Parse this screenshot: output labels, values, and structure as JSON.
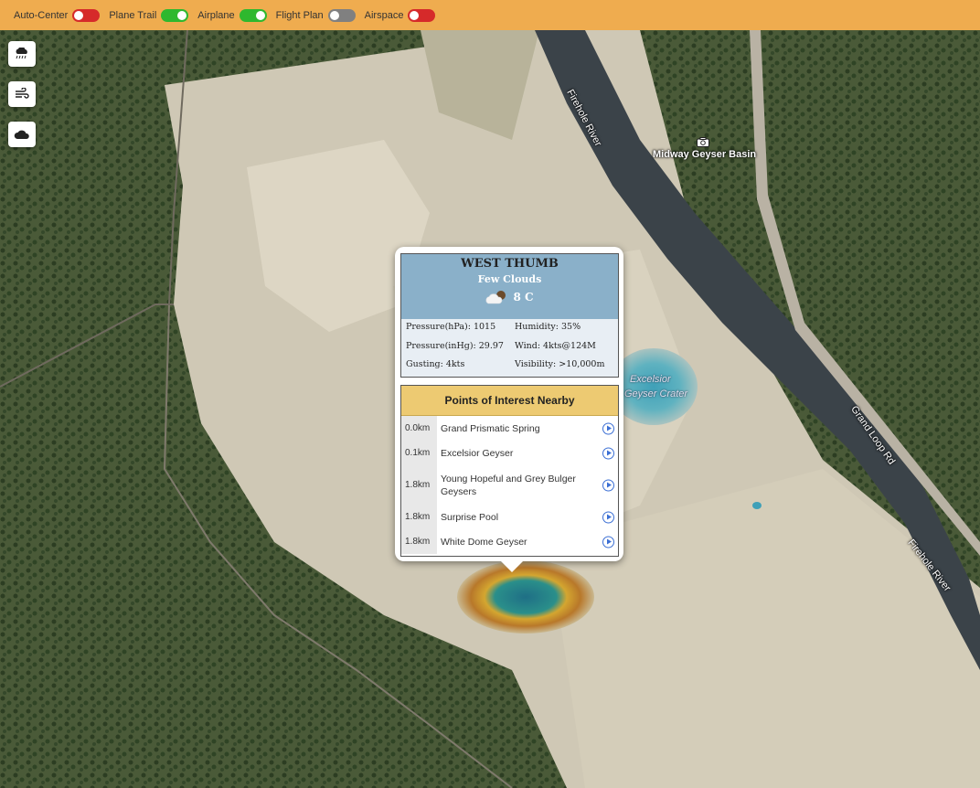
{
  "toolbar": {
    "toggles": [
      {
        "label": "Auto-Center",
        "state": "off",
        "color": "#d62a2a"
      },
      {
        "label": "Plane Trail",
        "state": "on",
        "color": "#2eb82e"
      },
      {
        "label": "Airplane",
        "state": "on",
        "color": "#2eb82e"
      },
      {
        "label": "Flight Plan",
        "state": "off",
        "color": "#808080"
      },
      {
        "label": "Airspace",
        "state": "off",
        "color": "#d62a2a"
      }
    ]
  },
  "map": {
    "buttons": [
      {
        "icon": "rain-cloud-icon"
      },
      {
        "icon": "wind-icon"
      },
      {
        "icon": "cloud-icon"
      }
    ],
    "labels": {
      "river_north": "Firehole River",
      "river_south": "Firehole River",
      "basin": "Midway Geyser Basin",
      "road": "Grand Loop Rd",
      "crater_line1": "Excelsior",
      "crater_line2": "Geyser Crater"
    }
  },
  "popup": {
    "close": "×",
    "weather": {
      "station": "WEST THUMB",
      "condition": "Few Clouds",
      "temperature": "8 C",
      "icon": "partly-cloudy-icon",
      "pressure_hpa": "Pressure(hPa): 1015",
      "humidity": "Humidity: 35%",
      "pressure_inhg": "Pressure(inHg): 29.97",
      "wind": "Wind: 4kts@124M",
      "gusting": "Gusting: 4kts",
      "visibility": "Visibility: >10,000m"
    },
    "poi": {
      "title": "Points of Interest Nearby",
      "items": [
        {
          "distance": "0.0km",
          "name": "Grand Prismatic Spring"
        },
        {
          "distance": "0.1km",
          "name": "Excelsior Geyser"
        },
        {
          "distance": "1.8km",
          "name": "Young Hopeful and Grey Bulger Geysers"
        },
        {
          "distance": "1.8km",
          "name": "Surprise Pool"
        },
        {
          "distance": "1.8km",
          "name": "White Dome Geyser"
        }
      ]
    }
  }
}
